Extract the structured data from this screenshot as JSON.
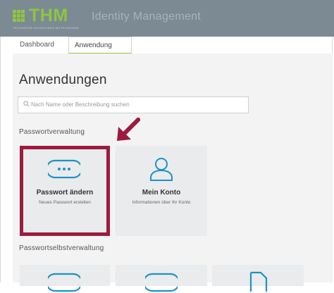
{
  "header": {
    "logo_text": "THM",
    "logo_subtitle": "TECHNISCHE HOCHSCHULE MITTELHESSEN",
    "app_title": "Identity Management",
    "brand_color": "#8dc63f",
    "bar_color": "#7c8a94"
  },
  "tabs": [
    {
      "label": "Dashboard",
      "active": false
    },
    {
      "label": "Anwendung",
      "active": true
    }
  ],
  "main": {
    "title": "Anwendungen",
    "search_placeholder": "Nach Name oder Beschreibung suchen",
    "sections": [
      {
        "label": "Passwortverwaltung",
        "tiles": [
          {
            "title": "Passwort ändern",
            "subtitle": "Neues Passwort erstellen",
            "icon": "chat-dots-icon",
            "highlighted": true
          },
          {
            "title": "Mein Konto",
            "subtitle": "Informationen über Ihr Konto",
            "icon": "user-icon",
            "highlighted": false
          }
        ]
      },
      {
        "label": "Passwortselbstverwaltung",
        "tiles": [
          {
            "icon": "chat-dots-icon"
          },
          {
            "icon": "chat-dots-icon"
          },
          {
            "icon": "document-icon"
          }
        ]
      }
    ]
  },
  "annotation": {
    "color": "#9c1b3e"
  }
}
